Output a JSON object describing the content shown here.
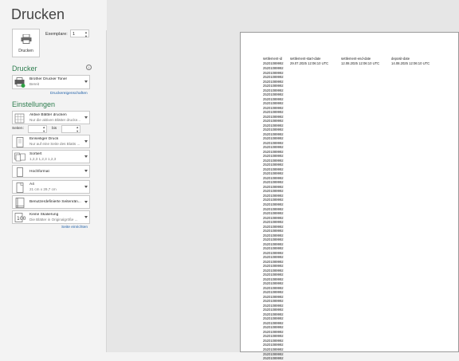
{
  "title": "Drucken",
  "print": {
    "button_label": "Drucken",
    "copies_label": "Exemplare:",
    "copies_value": "1"
  },
  "printer": {
    "section_title": "Drucker",
    "name": "Brother Drucker Toner",
    "status": "Bereit",
    "properties_link": "Druckereigenschaften"
  },
  "settings": {
    "section_title": "Einstellungen",
    "scope_l1": "Aktive Blätter drucken",
    "scope_l2": "Nur die aktiven Blätter drucke...",
    "pages_label": "Seiten:",
    "to_label": "bis",
    "sides_l1": "Einseitiger Druck",
    "sides_l2": "Nur auf eine Seite des Blatts ...",
    "collate_l1": "Sortiert",
    "collate_l2": "1,2,3   1,2,3   1,2,3",
    "orientation": "Hochformat",
    "paper_l1": "A4",
    "paper_l2": "21 cm x 29,7 cm",
    "margins": "Benutzerdefinierte Seitenrän...",
    "scaling_l1": "Keine Skalierung",
    "scaling_l2": "Die Blätter in Originalgröße ...",
    "page_setup_link": "Seite einrichten"
  },
  "preview": {
    "headers": [
      "settlement-id",
      "settlement-start-date",
      "settlement-end-date",
      "deposit-date"
    ],
    "first_row": [
      "25201089992",
      "29.07.2025 12:06:10 UTC",
      "12.08.2025 12:06:10 UTC",
      "14.08.2025 12:06:10 UTC"
    ],
    "ids": [
      "25201089992",
      "25201089992",
      "25201089992",
      "25201089992",
      "25201089992",
      "25201089992",
      "25201089992",
      "25201089992",
      "25201089992",
      "25201089992",
      "25201089992",
      "25201089992",
      "25201089992",
      "25201089992",
      "25201089992",
      "25201089992",
      "25201089992",
      "25201089992",
      "25201089992",
      "25201089992",
      "25201089992",
      "25201089992",
      "25201089992",
      "25201089992",
      "25201089992",
      "25201089992",
      "25201089992",
      "25201089992",
      "25201089992",
      "25201089992",
      "25201089992",
      "25201089992",
      "25201089992",
      "25201089992",
      "25201089992",
      "25201089992",
      "25201089992",
      "25201089992",
      "25201089992",
      "25201089992",
      "25201089992",
      "25201089992",
      "25201089992",
      "25201089992",
      "25201089992",
      "25201089992",
      "25201089992",
      "25201089992",
      "25201089992",
      "25201089992",
      "25201089992",
      "25201089992",
      "25201089992",
      "25201089992",
      "25201089992",
      "25201089992",
      "25201089992",
      "25201089992",
      "25201089992",
      "25201089992",
      "25201089992",
      "25201089992",
      "25201089992",
      "25201089992",
      "25201089992",
      "25201089992",
      "25201089992"
    ]
  }
}
